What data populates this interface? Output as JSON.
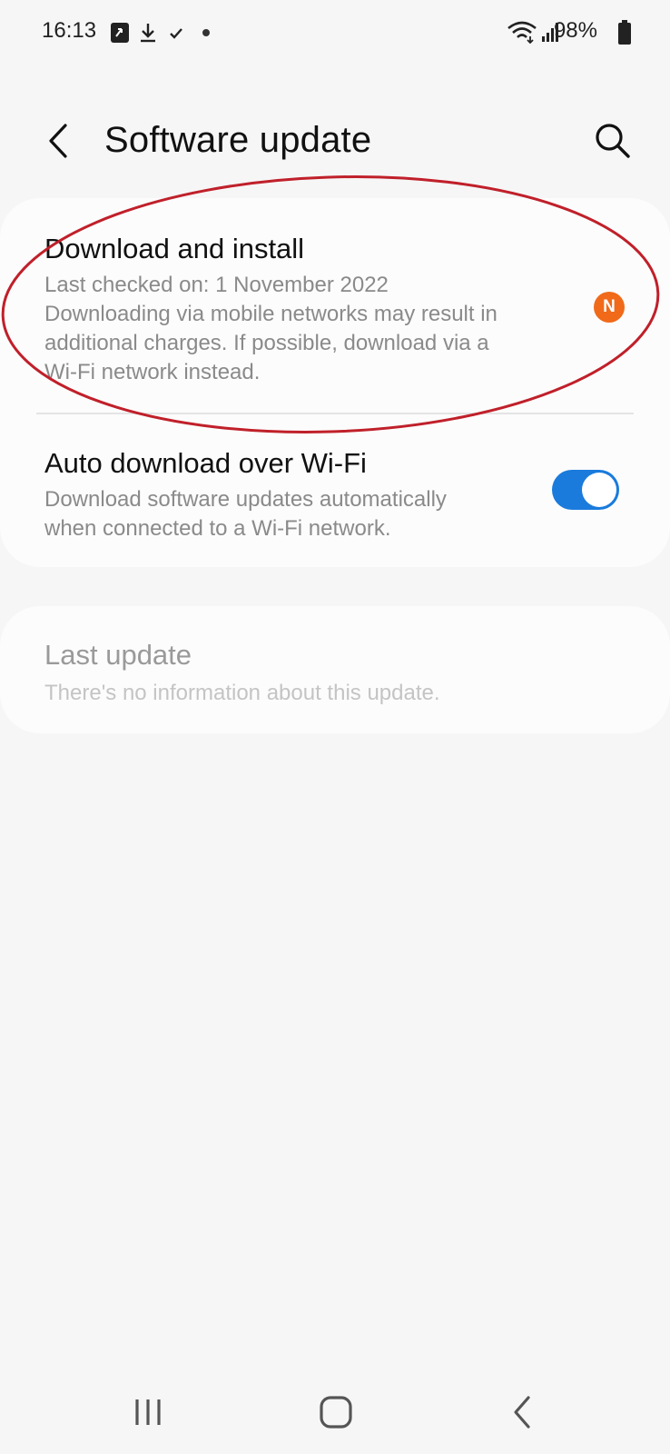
{
  "status_bar": {
    "time": "16:13",
    "battery": "98%",
    "icons": [
      "sync-icon",
      "download-icon",
      "check-icon",
      "dot-icon",
      "wifi-icon",
      "signal-icon",
      "battery-icon"
    ]
  },
  "header": {
    "title": "Software update",
    "back_icon": "chevron-left-icon",
    "search_icon": "search-icon"
  },
  "download_install": {
    "title": "Download and install",
    "last_checked": "Last checked on: 1 November 2022",
    "warning_line1": "Downloading via mobile networks may result in",
    "warning_line2": "additional charges. If possible, download via a",
    "warning_line3": "Wi-Fi network instead.",
    "badge": "N",
    "badge_color": "#f06a1a"
  },
  "auto_download": {
    "title": "Auto download over Wi-Fi",
    "desc_line1": "Download software updates automatically",
    "desc_line2": "when connected to a Wi-Fi network.",
    "enabled": true,
    "toggle_color": "#1a7bdc"
  },
  "last_update": {
    "title": "Last update",
    "desc": "There's no information about this update."
  },
  "annotation": {
    "shape": "ellipse",
    "color": "#c0202a"
  },
  "nav_bar": {
    "icons": [
      "recents-icon",
      "home-icon",
      "back-icon"
    ]
  }
}
